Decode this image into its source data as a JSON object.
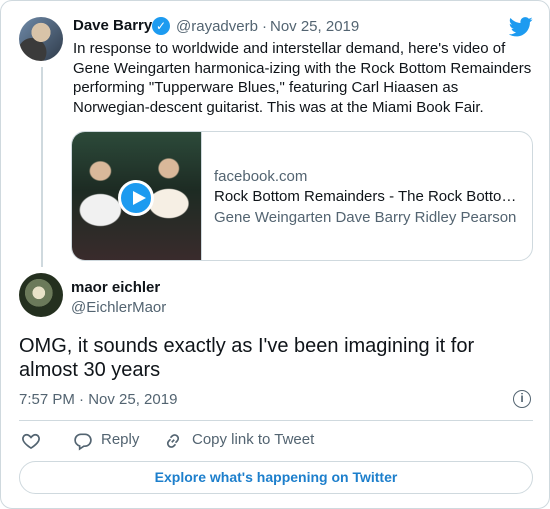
{
  "tweet": {
    "author_name": "Dave Barry",
    "author_handle": "@rayadverb",
    "separator": "·",
    "date": "Nov 25, 2019",
    "verified_mark": "✓",
    "text": "In response to worldwide and interstellar demand, here's video of Gene Weingarten harmonica-izing with the Rock Bottom Remainders performing \"Tupperware Blues,\" featuring Carl Hiaasen as Norwegian-descent guitarist. This was at the Miami Book Fair.",
    "link_card": {
      "domain": "facebook.com",
      "title": "Rock Bottom Remainders - The Rock Botto…",
      "description": "Gene Weingarten Dave Barry Ridley Pearson"
    }
  },
  "reply": {
    "author_name": "maor eichler",
    "author_handle": "@EichlerMaor",
    "text": "OMG, it sounds exactly as I've been imagining it for almost 30 years",
    "timestamp": "7:57 PM · Nov 25, 2019",
    "info_symbol": "i"
  },
  "actions": {
    "reply_label": "Reply",
    "copy_link_label": "Copy link to Tweet"
  },
  "footer": {
    "explore_label": "Explore what's happening on Twitter"
  },
  "icons": {
    "brand": "twitter-bird-icon",
    "verified": "verified-badge-icon",
    "like": "heart-icon",
    "reply": "reply-icon",
    "copy": "link-icon",
    "info": "info-icon",
    "play": "play-icon"
  },
  "colors": {
    "brand_blue": "#1d9bf0",
    "link_blue": "#1d7fcc",
    "secondary_text": "#536471",
    "border": "#cfd9de"
  }
}
